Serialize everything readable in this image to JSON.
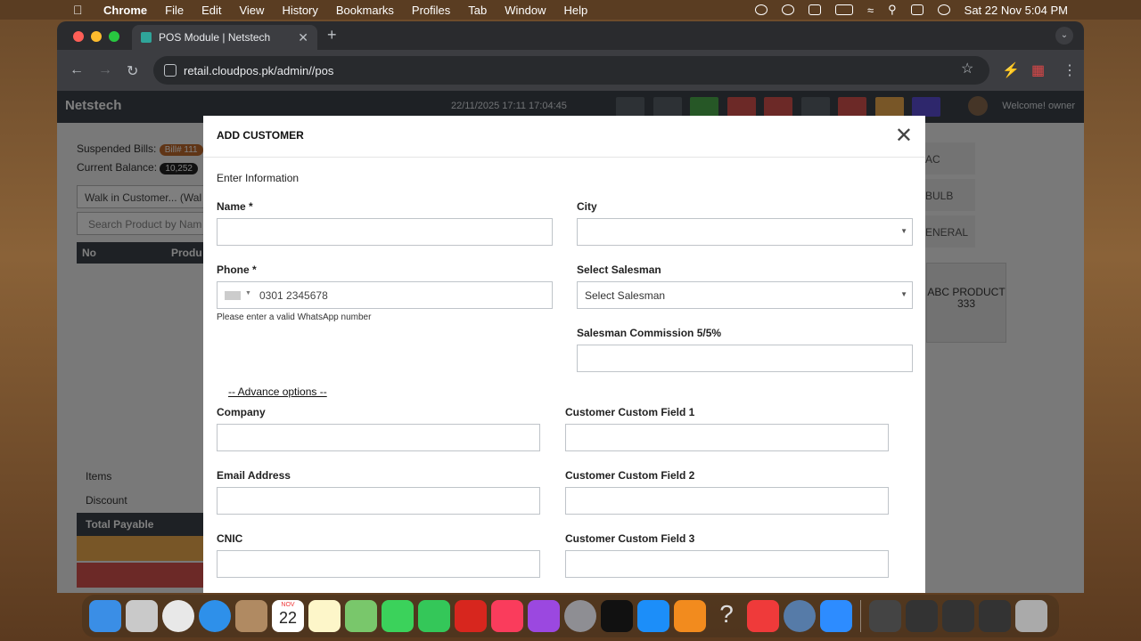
{
  "menubar": {
    "app": "Chrome",
    "items": [
      "File",
      "Edit",
      "View",
      "History",
      "Bookmarks",
      "Profiles",
      "Tab",
      "Window",
      "Help"
    ],
    "clock": "Sat 22 Nov  5:04 PM"
  },
  "browser": {
    "tab_title": "POS Module | Netstech",
    "url": "retail.cloudpos.pk/admin//pos"
  },
  "app": {
    "brand": "Netstech",
    "datetime": "22/11/2025 17:11 17:04:45",
    "welcome": "Welcome! owner",
    "header_button_colors": [
      "#5b636b",
      "#5b636b",
      "#4cae4c",
      "#d9534f",
      "#d9534f",
      "#5b636b",
      "#d9534f",
      "#f0ad4e",
      "#5c4fd9"
    ]
  },
  "background": {
    "suspended_label": "Suspended Bills:",
    "suspended_badge": "Bill# 111",
    "balance_label": "Current Balance:",
    "balance_value": "10,252",
    "customer_select": "Walk in Customer... (Wal",
    "search_placeholder": "Search Product by Nam",
    "table_no": "No",
    "table_product": "Produ",
    "items_label": "Items",
    "discount_label": "Discount",
    "total_label": "Total Payable",
    "categories": [
      "AC",
      "BULB",
      "ENERAL"
    ],
    "product_card": "ABC PRODUCT 333"
  },
  "modal": {
    "title": "ADD CUSTOMER",
    "section": "Enter Information",
    "name_label": "Name *",
    "name_value": "",
    "city_label": "City",
    "city_value": "",
    "phone_label": "Phone *",
    "phone_placeholder": "0301 2345678",
    "phone_help": "Please enter a valid WhatsApp number",
    "salesman_label": "Select Salesman",
    "salesman_value": "Select Salesman",
    "commission_label": "Salesman Commission 5/5%",
    "commission_value": "",
    "advance_link": "-- Advance options --",
    "company_label": "Company",
    "email_label": "Email Address",
    "cnic_label": "CNIC",
    "custom1_label": "Customer Custom Field 1",
    "custom2_label": "Customer Custom Field 2",
    "custom3_label": "Customer Custom Field 3"
  },
  "dock": {
    "calendar_month": "NOV",
    "calendar_day": "22",
    "apps": [
      "finder",
      "launchpad",
      "chrome",
      "safari",
      "contacts",
      "calendar",
      "notes",
      "maps",
      "messages",
      "facetime",
      "acrobat",
      "music",
      "podcasts",
      "settings",
      "tv",
      "app-store",
      "books",
      "help",
      "anydesk",
      "quicktime",
      "zoom"
    ]
  }
}
